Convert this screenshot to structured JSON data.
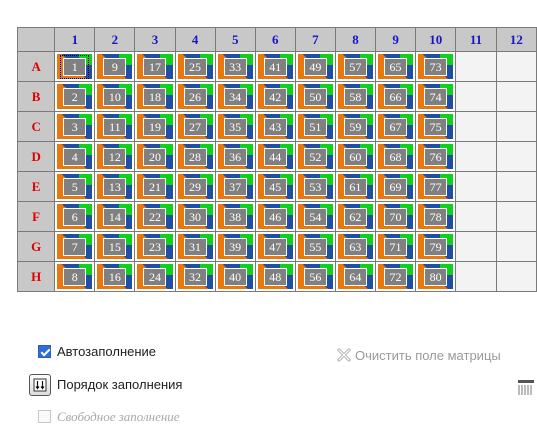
{
  "plate": {
    "column_headers": [
      "1",
      "2",
      "3",
      "4",
      "5",
      "6",
      "7",
      "8",
      "9",
      "10",
      "11",
      "12"
    ],
    "row_headers": [
      "A",
      "B",
      "C",
      "D",
      "E",
      "F",
      "G",
      "H"
    ],
    "wells": [
      [
        "1",
        "9",
        "17",
        "25",
        "33",
        "41",
        "49",
        "57",
        "65",
        "73",
        "",
        ""
      ],
      [
        "2",
        "10",
        "18",
        "26",
        "34",
        "42",
        "50",
        "58",
        "66",
        "74",
        "",
        ""
      ],
      [
        "3",
        "11",
        "19",
        "27",
        "35",
        "43",
        "51",
        "59",
        "67",
        "75",
        "",
        ""
      ],
      [
        "4",
        "12",
        "20",
        "28",
        "36",
        "44",
        "52",
        "60",
        "68",
        "76",
        "",
        ""
      ],
      [
        "5",
        "13",
        "21",
        "29",
        "37",
        "45",
        "53",
        "61",
        "69",
        "77",
        "",
        ""
      ],
      [
        "6",
        "14",
        "22",
        "30",
        "38",
        "46",
        "54",
        "62",
        "70",
        "78",
        "",
        ""
      ],
      [
        "7",
        "15",
        "23",
        "31",
        "39",
        "47",
        "55",
        "63",
        "71",
        "79",
        "",
        ""
      ],
      [
        "8",
        "16",
        "24",
        "32",
        "40",
        "48",
        "56",
        "64",
        "72",
        "80",
        "",
        ""
      ]
    ],
    "selected_well": "A1",
    "colors": {
      "header_bg": "#c8c8c8",
      "column_header_text": "#1515c8",
      "row_header_text": "#e00000",
      "well_orange": "#e8780e",
      "well_blue": "#1e4fa5",
      "well_green": "#0fd01a",
      "well_inner": "#808080"
    }
  },
  "options": {
    "autofill_label": "Автозаполнение",
    "autofill_checked": true,
    "fill_order_label": "Порядок заполнения",
    "free_fill_label": "Свободное заполнение",
    "free_fill_checked": false,
    "clear_matrix_label": "Очистить поле матрицы"
  },
  "icons": {
    "fill_order": "fill-order-icon",
    "clear_matrix": "clear-matrix-icon",
    "layout": "table-layout-icon"
  }
}
